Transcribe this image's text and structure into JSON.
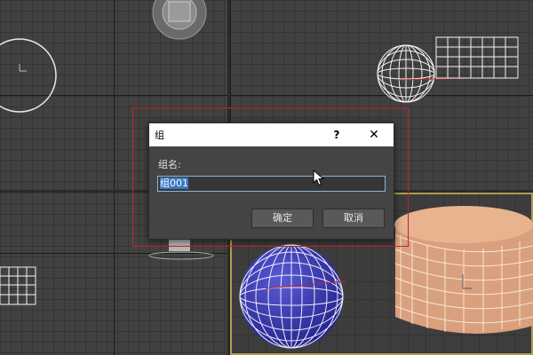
{
  "dialog": {
    "title": "组",
    "help_glyph": "?",
    "close_glyph": "✕",
    "name_label": "组名:",
    "name_value": "组001",
    "ok_label": "确定",
    "cancel_label": "取消"
  },
  "viewports": [
    {
      "id": "top",
      "active": false
    },
    {
      "id": "front",
      "active": false
    },
    {
      "id": "left",
      "active": false
    },
    {
      "id": "perspective",
      "active": true
    }
  ],
  "colors": {
    "selection_box": "#c0262a",
    "sphere_blue": "#3131a8",
    "cylinder": "#d9a07d",
    "active_viewport_border": "#b39a50"
  },
  "icons": [
    "help-icon",
    "close-icon",
    "mouse-cursor-icon"
  ]
}
